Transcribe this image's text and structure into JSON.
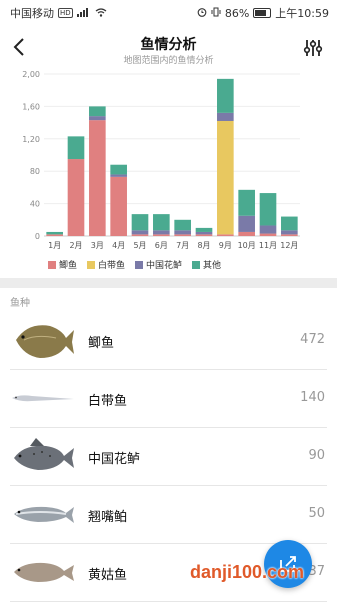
{
  "status_bar": {
    "carrier": "中国移动",
    "hd": "HD",
    "signal": "⁴⁶",
    "battery_pct": "86%",
    "time": "上午10:59"
  },
  "header": {
    "title": "鱼情分析",
    "subtitle": "地图范围内的鱼情分析"
  },
  "chart_data": {
    "type": "bar",
    "stacked": true,
    "categories": [
      "1月",
      "2月",
      "3月",
      "4月",
      "5月",
      "6月",
      "7月",
      "8月",
      "9月",
      "10月",
      "11月",
      "12月"
    ],
    "y_ticks": [
      "0",
      "40",
      "80",
      "1,20",
      "1,60",
      "2,00"
    ],
    "ylim": [
      0,
      200
    ],
    "grid": true,
    "legend_placement": "bottom",
    "series": [
      {
        "name": "鲫鱼",
        "color": "#e08080",
        "values": [
          2,
          95,
          143,
          73,
          2,
          2,
          2,
          2,
          2,
          5,
          3,
          2
        ]
      },
      {
        "name": "白带鱼",
        "color": "#e8c860",
        "values": [
          0,
          0,
          0,
          0,
          0,
          0,
          0,
          0,
          140,
          0,
          0,
          0
        ]
      },
      {
        "name": "中国花鲈",
        "color": "#7a7aa8",
        "values": [
          0,
          0,
          5,
          3,
          5,
          5,
          5,
          3,
          10,
          20,
          10,
          5
        ]
      },
      {
        "name": "其他",
        "color": "#4aaa90",
        "values": [
          3,
          28,
          12,
          12,
          20,
          20,
          13,
          5,
          42,
          32,
          40,
          17
        ]
      }
    ]
  },
  "section_label": "鱼种",
  "fish": [
    {
      "name": "鲫鱼",
      "count": "472"
    },
    {
      "name": "白带鱼",
      "count": "140"
    },
    {
      "name": "中国花鲈",
      "count": "90"
    },
    {
      "name": "翘嘴鲌",
      "count": "50"
    },
    {
      "name": "黄姑鱼",
      "count": "37"
    }
  ],
  "watermark": "danji100.com"
}
